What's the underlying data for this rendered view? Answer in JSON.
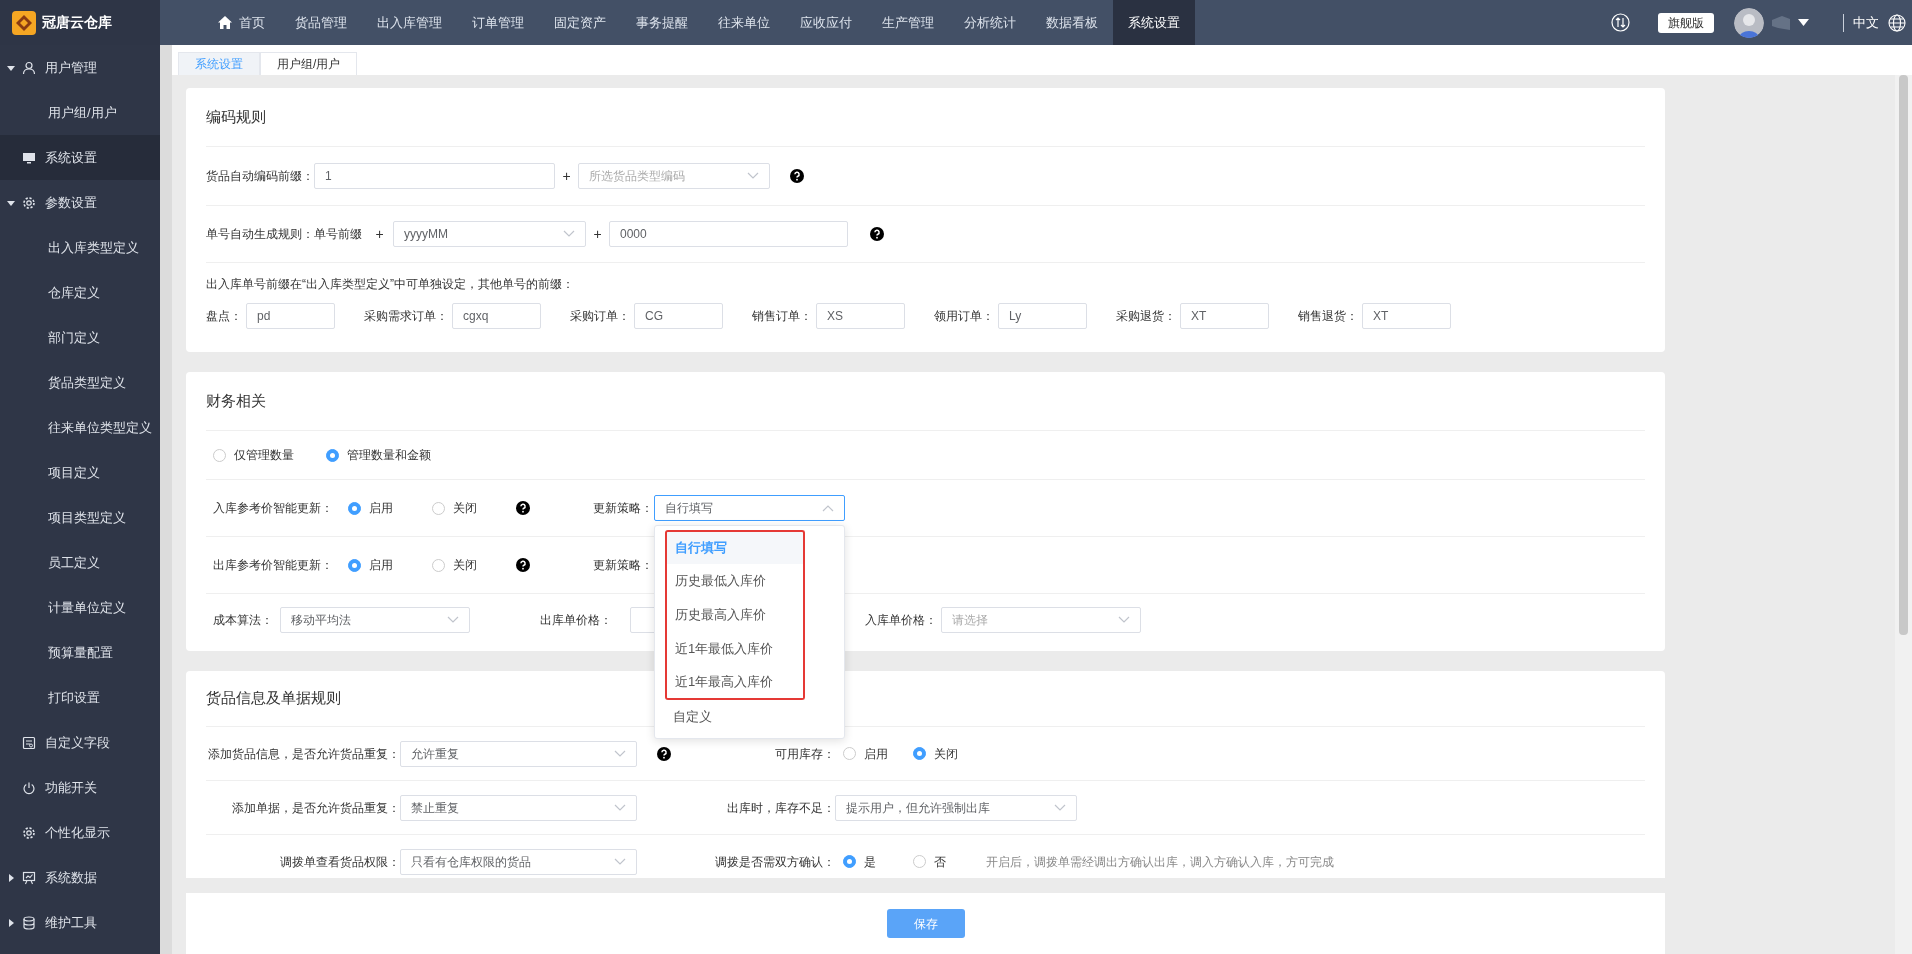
{
  "app": {
    "name": "冠唐云仓库"
  },
  "top_nav": [
    {
      "label": "首页",
      "selected": false
    },
    {
      "label": "货品管理",
      "selected": false
    },
    {
      "label": "出入库管理",
      "selected": false
    },
    {
      "label": "订单管理",
      "selected": false
    },
    {
      "label": "固定资产",
      "selected": false
    },
    {
      "label": "事务提醒",
      "selected": false
    },
    {
      "label": "往来单位",
      "selected": false
    },
    {
      "label": "应收应付",
      "selected": false
    },
    {
      "label": "生产管理",
      "selected": false
    },
    {
      "label": "分析统计",
      "selected": false
    },
    {
      "label": "数据看板",
      "selected": false
    },
    {
      "label": "系统设置",
      "selected": true
    }
  ],
  "header_right": {
    "edition": "旗舰版",
    "language": "中文"
  },
  "sidebar": {
    "items": [
      {
        "label": "用户管理",
        "expanded": true,
        "selected": false,
        "children": [
          {
            "label": "用户组/用户",
            "selected": false
          }
        ]
      },
      {
        "label": "系统设置",
        "selected": true
      },
      {
        "label": "参数设置",
        "expanded": true,
        "selected": false,
        "children": [
          {
            "label": "出入库类型定义",
            "selected": false
          },
          {
            "label": "仓库定义",
            "selected": false
          },
          {
            "label": "部门定义",
            "selected": false
          },
          {
            "label": "货品类型定义",
            "selected": false
          },
          {
            "label": "往来单位类型定义",
            "selected": false
          },
          {
            "label": "项目定义",
            "selected": false
          },
          {
            "label": "项目类型定义",
            "selected": false
          },
          {
            "label": "员工定义",
            "selected": false
          },
          {
            "label": "计量单位定义",
            "selected": false
          },
          {
            "label": "预算量配置",
            "selected": false
          },
          {
            "label": "打印设置",
            "selected": false
          }
        ]
      },
      {
        "label": "自定义字段",
        "selected": false
      },
      {
        "label": "功能开关",
        "selected": false
      },
      {
        "label": "个性化显示",
        "selected": false
      },
      {
        "label": "系统数据",
        "expanded": false,
        "selected": false
      },
      {
        "label": "维护工具",
        "expanded": false,
        "selected": false
      }
    ]
  },
  "tabs": [
    {
      "label": "系统设置",
      "selected": true
    },
    {
      "label": "用户组/用户",
      "selected": false
    }
  ],
  "coding_rules": {
    "title": "编码规则",
    "goods_prefix": {
      "label": "货品自动编码前缀：",
      "value": "1",
      "plus": "+",
      "select_placeholder": "所选货品类型编码",
      "help": true
    },
    "order_rule": {
      "label": "单号自动生成规则：单号前缀",
      "plus": "+",
      "select_value": "yyyyMM",
      "plus_2": "+",
      "input_value": "0000",
      "help": true
    },
    "note": "出入库单号前缀在“出入库类型定义”中可单独设定，其他单号的前缀：",
    "prefixes": [
      {
        "label": "盘点：",
        "value": "pd"
      },
      {
        "label": "采购需求订单：",
        "value": "cgxq"
      },
      {
        "label": "采购订单：",
        "value": "CG"
      },
      {
        "label": "销售订单：",
        "value": "XS"
      },
      {
        "label": "领用订单：",
        "value": "Ly"
      },
      {
        "label": "采购退货：",
        "value": "XT"
      },
      {
        "label": "销售退货：",
        "value": "XT"
      }
    ]
  },
  "finance": {
    "title": "财务相关",
    "mode_options": [
      {
        "label": "仅管理数量",
        "selected": false
      },
      {
        "label": "管理数量和金额",
        "selected": true
      }
    ],
    "price_updates": [
      {
        "label": "入库参考价智能更新：",
        "options": [
          {
            "label": "启用",
            "selected": true
          },
          {
            "label": "关闭",
            "selected": false
          }
        ],
        "help": true,
        "strategy_label": "更新策略：",
        "strategy_value": "自行填写",
        "open": true
      },
      {
        "label": "出库参考价智能更新：",
        "options": [
          {
            "label": "启用",
            "selected": true
          },
          {
            "label": "关闭",
            "selected": false
          }
        ],
        "help": true,
        "strategy_label": "更新策略："
      }
    ],
    "cost_fields": [
      {
        "label": "成本算法：",
        "value": "移动平均法"
      },
      {
        "label": "出库单价格："
      },
      {
        "label": "入库单价格：",
        "placeholder": "请选择"
      }
    ],
    "dropdown_options": [
      {
        "label": "自行填写",
        "selected": true,
        "annotated": true
      },
      {
        "label": "历史最低入库价",
        "selected": false,
        "annotated": true
      },
      {
        "label": "历史最高入库价",
        "selected": false,
        "annotated": true
      },
      {
        "label": "近1年最低入库价",
        "selected": false,
        "annotated": true
      },
      {
        "label": "近1年最高入库价",
        "selected": false,
        "annotated": true
      },
      {
        "label": "自定义",
        "selected": false,
        "annotated": false
      }
    ]
  },
  "goods_rules": {
    "title": "货品信息及单据规则",
    "rows": [
      {
        "left": {
          "label": "添加货品信息，是否允许货品重复：",
          "value": "允许重复",
          "help": true
        },
        "right": {
          "kind": "radio",
          "label": "可用库存：",
          "options": [
            {
              "label": "启用",
              "selected": false
            },
            {
              "label": "关闭",
              "selected": true
            }
          ]
        }
      },
      {
        "left": {
          "label": "添加单据，是否允许货品重复：",
          "value": "禁止重复"
        },
        "right": {
          "kind": "select",
          "label": "出库时，库存不足：",
          "value": "提示用户，但允许强制出库"
        }
      },
      {
        "left": {
          "label": "调拨单查看货品权限：",
          "value": "只看有仓库权限的货品"
        },
        "right": {
          "kind": "radio",
          "label": "调拨是否需双方确认：",
          "options": [
            {
              "label": "是",
              "selected": true
            },
            {
              "label": "否",
              "selected": false
            }
          ],
          "note": "开启后，调拨单需经调出方确认出库，调入方确认入库，方可完成"
        }
      }
    ]
  },
  "save_button": {
    "label": "保存"
  }
}
